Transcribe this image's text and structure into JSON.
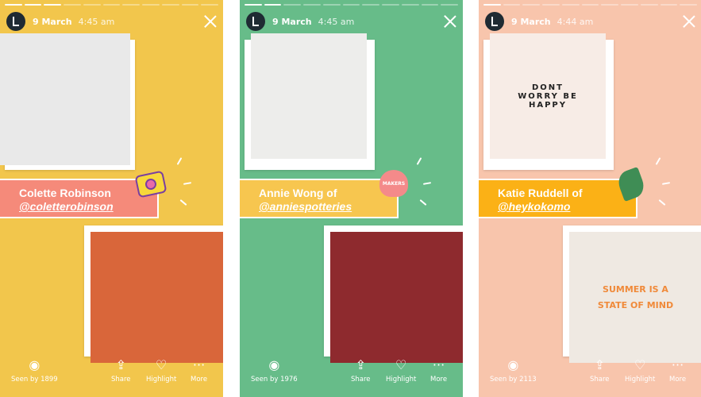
{
  "stories": [
    {
      "bg": "#f2c64c",
      "label_bg": "#f58a7a",
      "date": "9 March",
      "time": "4:45 am",
      "name": "Colette Robinson",
      "handle": "@coletterobinson",
      "seen": "Seen by 1899",
      "progress_done": 3,
      "segments": 11,
      "sticker": "camera-sticker",
      "sticker_text": "",
      "top_photo_text": "",
      "bottom_photo_text": "",
      "top_photo": "#e9e9e9",
      "bottom_photo": "#d9663a"
    },
    {
      "bg": "#67bc89",
      "label_bg": "#f7c64f",
      "date": "9 March",
      "time": "4:45 am",
      "name": "Annie Wong of",
      "handle": "@anniespotteries",
      "seen": "Seen by 1976",
      "progress_done": 2,
      "segments": 11,
      "sticker": "heart-sticker",
      "sticker_text": "MAKERS",
      "top_photo_text": "",
      "bottom_photo_text": "",
      "top_photo": "#ededeb",
      "bottom_photo": "#8e2a2e"
    },
    {
      "bg": "#f8c5ac",
      "label_bg": "#fbb116",
      "date": "9 March",
      "time": "4:44 am",
      "name": "Katie Ruddell of",
      "handle": "@heykokomo",
      "seen": "Seen by 2113",
      "progress_done": 1,
      "segments": 11,
      "sticker": "leaf-sticker",
      "sticker_text": "",
      "top_photo_text": "DONT WORRY BE HAPPY",
      "bottom_photo_text": "SUMMER IS A STATE OF MIND",
      "top_photo": "#f7ece6",
      "bottom_photo": "#efe9e2"
    }
  ],
  "footer": {
    "share": "Share",
    "highlight": "Highlight",
    "more": "More"
  },
  "icons": {
    "seen": "eye-icon",
    "share": "share-icon",
    "highlight": "highlight-heart-icon",
    "more": "more-dots-icon",
    "close": "close-icon"
  }
}
